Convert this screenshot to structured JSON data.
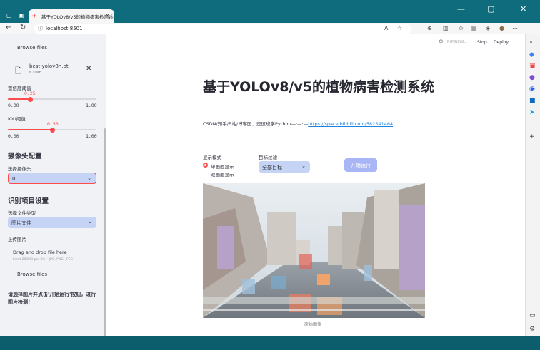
{
  "browser": {
    "tab_title": "基于YOLOv8/v5的植物病害检测系统",
    "url": "localhost:8501"
  },
  "app_header": {
    "running_label": "RUNNING...",
    "stop_label": "Stop",
    "deploy_label": "Deploy",
    "menu_icon": "⋮"
  },
  "sidebar": {
    "model_upload": {
      "browse_label": "Browse files",
      "file_name": "best-yolov8n.pt",
      "file_size": "6.0MB"
    },
    "conf_slider": {
      "label": "置信度阈值",
      "value": 0.25,
      "value_text": "0.25",
      "min_text": "0.00",
      "max_text": "1.00"
    },
    "iou_slider": {
      "label": "IOU阈值",
      "value": 0.5,
      "value_text": "0.50",
      "min_text": "0.00",
      "max_text": "1.00"
    },
    "camera_section": {
      "title": "摄像头配置",
      "select_label": "选择摄像头",
      "selected": "0"
    },
    "project_section": {
      "title": "识别项目设置",
      "file_type_label": "选择文件类型",
      "file_type_selected": "图片文件"
    },
    "image_upload": {
      "label": "上传图片",
      "drop_text": "Drag and drop file here",
      "limit_text": "Limit 200MB per file • JPG, PNG, JPEG",
      "browse_label": "Browse files"
    },
    "hint": "请选择图片并点击'开始运行'按钮，进行图片检测！"
  },
  "main": {
    "title": "基于YOLOv8/v5的植物病害检测系统",
    "credit_prefix": "CSDN/知乎/B站/博客园：逗逗班学Python—·—·—",
    "credit_link": "https://space.bilibili.com/582341464",
    "display_mode_label": "显示模式",
    "display_modes": [
      "单画面显示",
      "双画面显示"
    ],
    "target_filter_label": "目标过滤",
    "target_filter_selected": "全部目标",
    "run_button": "开始运行",
    "image_caption": "原始图像"
  },
  "colors": {
    "accent": "#ff4b4b",
    "sidebar_bg": "#f0f2f6",
    "select_bg": "#c5d4f4",
    "run_button_bg": "#a9b6f6",
    "link": "#1c83e1",
    "browser_frame": "#0f6c7c"
  }
}
